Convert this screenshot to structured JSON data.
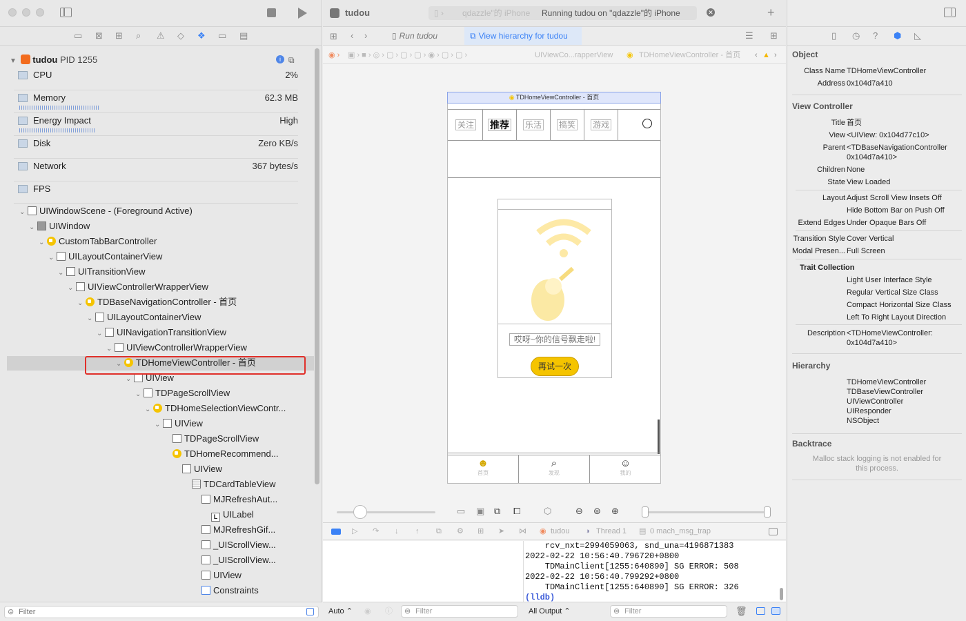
{
  "app": {
    "title": "tudou",
    "status": "Running tudou on \"qdazzle\"的 iPhone",
    "device_prefix": "qdazzle\"的 iPhone"
  },
  "process": {
    "name": "tudou",
    "pid": "PID 1255"
  },
  "gauges": [
    {
      "label": "CPU",
      "value": "2%",
      "icon": "cpu-icon"
    },
    {
      "label": "Memory",
      "value": "62.3 MB",
      "icon": "memory-icon"
    },
    {
      "label": "Energy Impact",
      "value": "High",
      "icon": "energy-icon"
    },
    {
      "label": "Disk",
      "value": "Zero KB/s",
      "icon": "disk-icon"
    },
    {
      "label": "Network",
      "value": "367 bytes/s",
      "icon": "network-icon"
    },
    {
      "label": "FPS",
      "value": "",
      "icon": "fps-icon"
    }
  ],
  "tree": [
    {
      "label": "UIWindowScene - (Foreground Active)",
      "depth": 0,
      "icon": "window-scene-icon",
      "open": true
    },
    {
      "label": "UIWindow",
      "depth": 1,
      "icon": "window-icon",
      "open": true
    },
    {
      "label": "CustomTabBarController",
      "depth": 2,
      "icon": "view-controller-icon",
      "open": true
    },
    {
      "label": "UILayoutContainerView",
      "depth": 3,
      "icon": "view-icon",
      "open": true
    },
    {
      "label": "UITransitionView",
      "depth": 4,
      "icon": "view-icon",
      "open": true
    },
    {
      "label": "UIViewControllerWrapperView",
      "depth": 5,
      "icon": "view-icon",
      "open": true
    },
    {
      "label": "TDBaseNavigationController - 首页",
      "depth": 6,
      "icon": "nav-controller-icon",
      "open": true
    },
    {
      "label": "UILayoutContainerView",
      "depth": 7,
      "icon": "view-icon",
      "open": true
    },
    {
      "label": "UINavigationTransitionView",
      "depth": 8,
      "icon": "view-icon",
      "open": true
    },
    {
      "label": "UIViewControllerWrapperView",
      "depth": 9,
      "icon": "view-icon",
      "open": true
    },
    {
      "label": "TDHomeViewController - 首页",
      "depth": 10,
      "icon": "view-controller-icon",
      "open": true,
      "selected": true
    },
    {
      "label": "UIView",
      "depth": 11,
      "icon": "view-icon",
      "open": true
    },
    {
      "label": "TDPageScrollView",
      "depth": 12,
      "icon": "view-icon",
      "open": true
    },
    {
      "label": "TDHomeSelectionViewContr...",
      "depth": 13,
      "icon": "view-controller-icon",
      "open": true
    },
    {
      "label": "UIView",
      "depth": 14,
      "icon": "view-icon",
      "open": true
    },
    {
      "label": "TDPageScrollView",
      "depth": 15,
      "icon": "view-icon",
      "open": false
    },
    {
      "label": "TDHomeRecommend...",
      "depth": 15,
      "icon": "view-controller-icon",
      "open": false
    },
    {
      "label": "UIView",
      "depth": 16,
      "icon": "view-icon",
      "open": false
    },
    {
      "label": "TDCardTableView",
      "depth": 17,
      "icon": "table-icon",
      "open": false
    },
    {
      "label": "MJRefreshAut...",
      "depth": 18,
      "icon": "view-icon",
      "open": false
    },
    {
      "label": "UILabel",
      "depth": 19,
      "icon": "label-icon",
      "open": false
    },
    {
      "label": "MJRefreshGif...",
      "depth": 18,
      "icon": "view-icon",
      "open": false
    },
    {
      "label": "_UIScrollView...",
      "depth": 18,
      "icon": "view-icon",
      "open": false
    },
    {
      "label": "_UIScrollView...",
      "depth": 18,
      "icon": "view-icon",
      "open": false
    },
    {
      "label": "UIView",
      "depth": 18,
      "icon": "view-icon",
      "open": false
    },
    {
      "label": "Constraints",
      "depth": 18,
      "icon": "constraints-icon",
      "open": false
    }
  ],
  "left_filter_placeholder": "Filter",
  "center_tabs": {
    "run": "Run tudou",
    "hierarchy": "View hierarchy for tudou"
  },
  "jumpbar": {
    "item1": "UIViewCo...rapperView",
    "item2": "TDHomeViewController - 首页"
  },
  "canvas": {
    "nav_title": "TDHomeViewController - 首页",
    "tabs": [
      "关注",
      "推荐",
      "乐活",
      "搞笑",
      "游戏"
    ],
    "empty_message": "哎呀~你的信号飘走啦!",
    "retry": "再试一次",
    "tabbar": [
      "首页",
      "发现",
      "我的"
    ]
  },
  "debug_bar": {
    "process": "tudou",
    "thread": "Thread 1",
    "frame": "0 mach_msg_trap"
  },
  "console": {
    "auto": "Auto",
    "filter_placeholder": "Filter",
    "output": "All Output",
    "lines": [
      "    rcv_nxt=2994059063, snd_una=4196871383",
      "2022-02-22 10:56:40.796720+0800",
      "    TDMainClient[1255:640890] SG ERROR: 508",
      "2022-02-22 10:56:40.799292+0800",
      "    TDMainClient[1255:640890] SG ERROR: 326"
    ],
    "prompt": "(lldb)"
  },
  "inspector": {
    "object_header": "Object",
    "class_name_k": "Class Name",
    "class_name_v": "TDHomeViewController",
    "address_k": "Address",
    "address_v": "0x104d7a410",
    "vc_header": "View Controller",
    "title_k": "Title",
    "title_v": "首页",
    "view_k": "View",
    "view_v": "<UIView: 0x104d77c10>",
    "parent_k": "Parent",
    "parent_v1": "<TDBaseNavigationController",
    "parent_v2": "0x104d7a410>",
    "children_k": "Children",
    "children_v": "None",
    "state_k": "State",
    "state_v": "View Loaded",
    "layout_k": "Layout",
    "layout_v1": "Adjust Scroll View Insets Off",
    "layout_v2": "Hide Bottom Bar on Push Off",
    "extend_k": "Extend Edges",
    "extend_v": "Under Opaque Bars Off",
    "transition_k": "Transition Style",
    "transition_v": "Cover Vertical",
    "modal_k": "Modal Presen...",
    "modal_v": "Full Screen",
    "trait_header": "Trait Collection",
    "traits": [
      "Light User Interface Style",
      "Regular Vertical Size Class",
      "Compact Horizontal Size Class",
      "Left To Right Layout Direction"
    ],
    "desc_k": "Description",
    "desc_v1": "<TDHomeViewController:",
    "desc_v2": "0x104d7a410>",
    "hierarchy_header": "Hierarchy",
    "hierarchy": [
      "TDHomeViewController",
      "TDBaseViewController",
      "UIViewController",
      "UIResponder",
      "NSObject"
    ],
    "backtrace_header": "Backtrace",
    "backtrace_note1": "Malloc stack logging is not enabled for",
    "backtrace_note2": "this process."
  },
  "colors": {
    "accent": "#3b82f6",
    "selection_outline": "#e0302a",
    "vc_yellow": "#f5c400",
    "warn": "#f5b800"
  }
}
